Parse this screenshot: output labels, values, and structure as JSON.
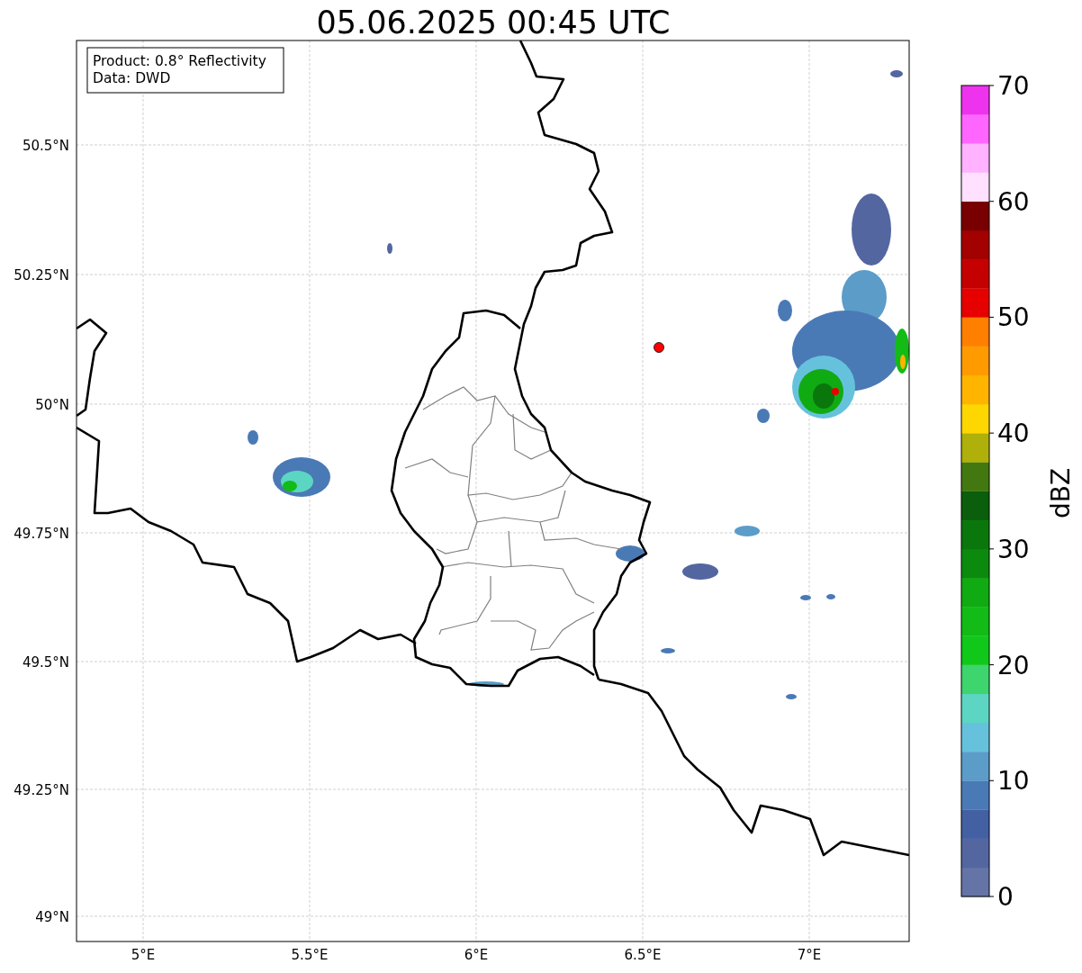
{
  "title": "05.06.2025 00:45 UTC",
  "info_box": {
    "lines": [
      "Product: 0.8° Reflectivity",
      "Data: DWD"
    ]
  },
  "map": {
    "lat_ticks": [
      "50.5°N",
      "50.25°N",
      "50°N",
      "49.75°N",
      "49.5°N",
      "49.25°N",
      "49°N"
    ],
    "lon_ticks": [
      "5°E",
      "5.5°E",
      "6°E",
      "6.5°E",
      "7°E"
    ]
  },
  "colorbar": {
    "label": "dBZ",
    "ticks": [
      "70",
      "60",
      "50",
      "40",
      "30",
      "20",
      "10",
      "0"
    ],
    "bands": [
      {
        "color": "#6474a6"
      },
      {
        "color": "#5366a0"
      },
      {
        "color": "#4360a3"
      },
      {
        "color": "#4a7ab5"
      },
      {
        "color": "#5b9cc8"
      },
      {
        "color": "#66c2dc"
      },
      {
        "color": "#5cd6c2"
      },
      {
        "color": "#3ed46e"
      },
      {
        "color": "#10c81a"
      },
      {
        "color": "#12bb16"
      },
      {
        "color": "#10aa12"
      },
      {
        "color": "#0c8a0e"
      },
      {
        "color": "#0a770c"
      },
      {
        "color": "#0b5e0b"
      },
      {
        "color": "#437810"
      },
      {
        "color": "#afb00a"
      },
      {
        "color": "#ffd700"
      },
      {
        "color": "#ffb400"
      },
      {
        "color": "#ff9b00"
      },
      {
        "color": "#ff7f00"
      },
      {
        "color": "#e60000"
      },
      {
        "color": "#c40000"
      },
      {
        "color": "#a30000"
      },
      {
        "color": "#780000"
      },
      {
        "color": "#ffe0ff"
      },
      {
        "color": "#ffb2ff"
      },
      {
        "color": "#ff66ff"
      },
      {
        "color": "#ee33ee"
      }
    ]
  }
}
